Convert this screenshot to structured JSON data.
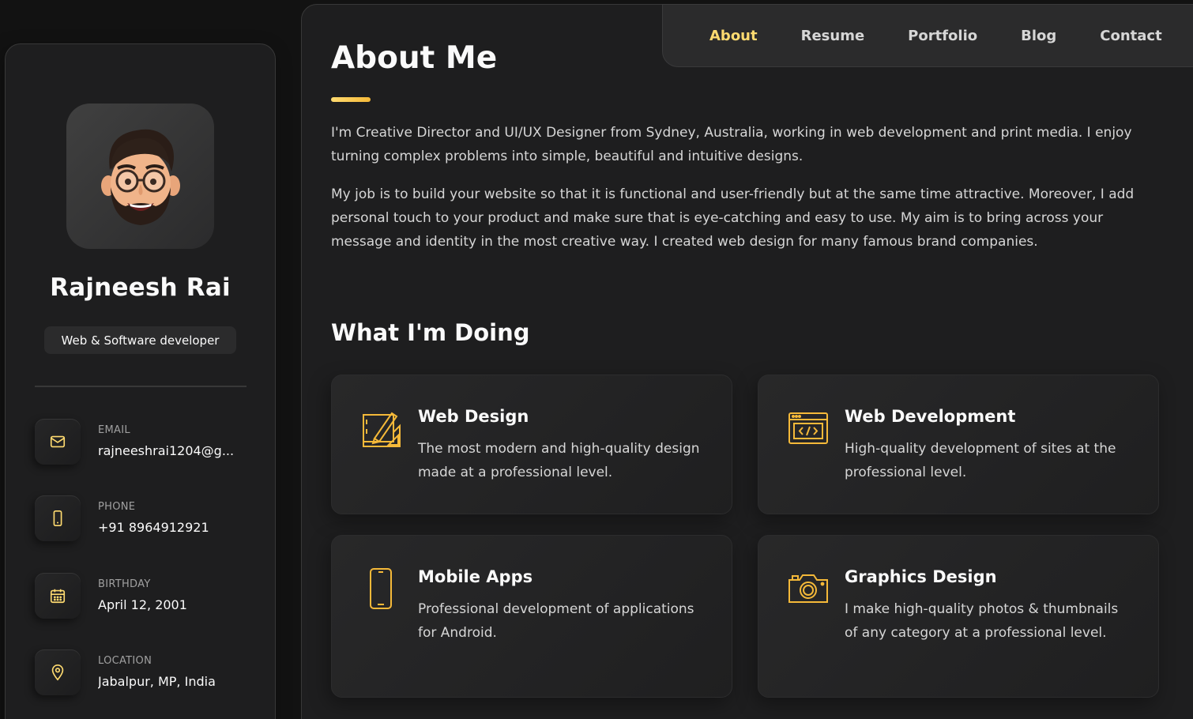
{
  "profile": {
    "name": "Rajneesh Rai",
    "title": "Web & Software developer",
    "avatar_icon": "memoji-avatar"
  },
  "contacts": [
    {
      "label": "Email",
      "value": "rajneeshrai1204@g...",
      "icon": "mail-icon"
    },
    {
      "label": "Phone",
      "value": "+91 8964912921",
      "icon": "phone-icon"
    },
    {
      "label": "Birthday",
      "value": "April 12, 2001",
      "icon": "calendar-icon"
    },
    {
      "label": "Location",
      "value": "Jabalpur, MP, India",
      "icon": "location-pin-icon"
    }
  ],
  "nav": {
    "items": [
      "About",
      "Resume",
      "Portfolio",
      "Blog",
      "Contact"
    ],
    "active": "About"
  },
  "about": {
    "title": "About Me",
    "paragraphs": [
      "I'm Creative Director and UI/UX Designer from Sydney, Australia, working in web development and print media. I enjoy turning complex problems into simple, beautiful and intuitive designs.",
      "My job is to build your website so that it is functional and user-friendly but at the same time attractive. Moreover, I add personal touch to your product and make sure that is eye-catching and easy to use. My aim is to bring across your message and identity in the most creative way. I created web design for many famous brand companies."
    ]
  },
  "services": {
    "title": "What I'm Doing",
    "items": [
      {
        "title": "Web Design",
        "text": "The most modern and high-quality design made at a professional level.",
        "icon": "design-tools-icon"
      },
      {
        "title": "Web Development",
        "text": "High-quality development of sites at the professional level.",
        "icon": "code-window-icon"
      },
      {
        "title": "Mobile Apps",
        "text": "Professional development of applications for Android.",
        "icon": "smartphone-icon"
      },
      {
        "title": "Graphics Design",
        "text": "I make high-quality photos & thumbnails of any category at a professional level.",
        "icon": "camera-icon"
      }
    ]
  },
  "colors": {
    "accent": "#ffdb70",
    "background": "#121212",
    "card": "#1e1e1f"
  }
}
